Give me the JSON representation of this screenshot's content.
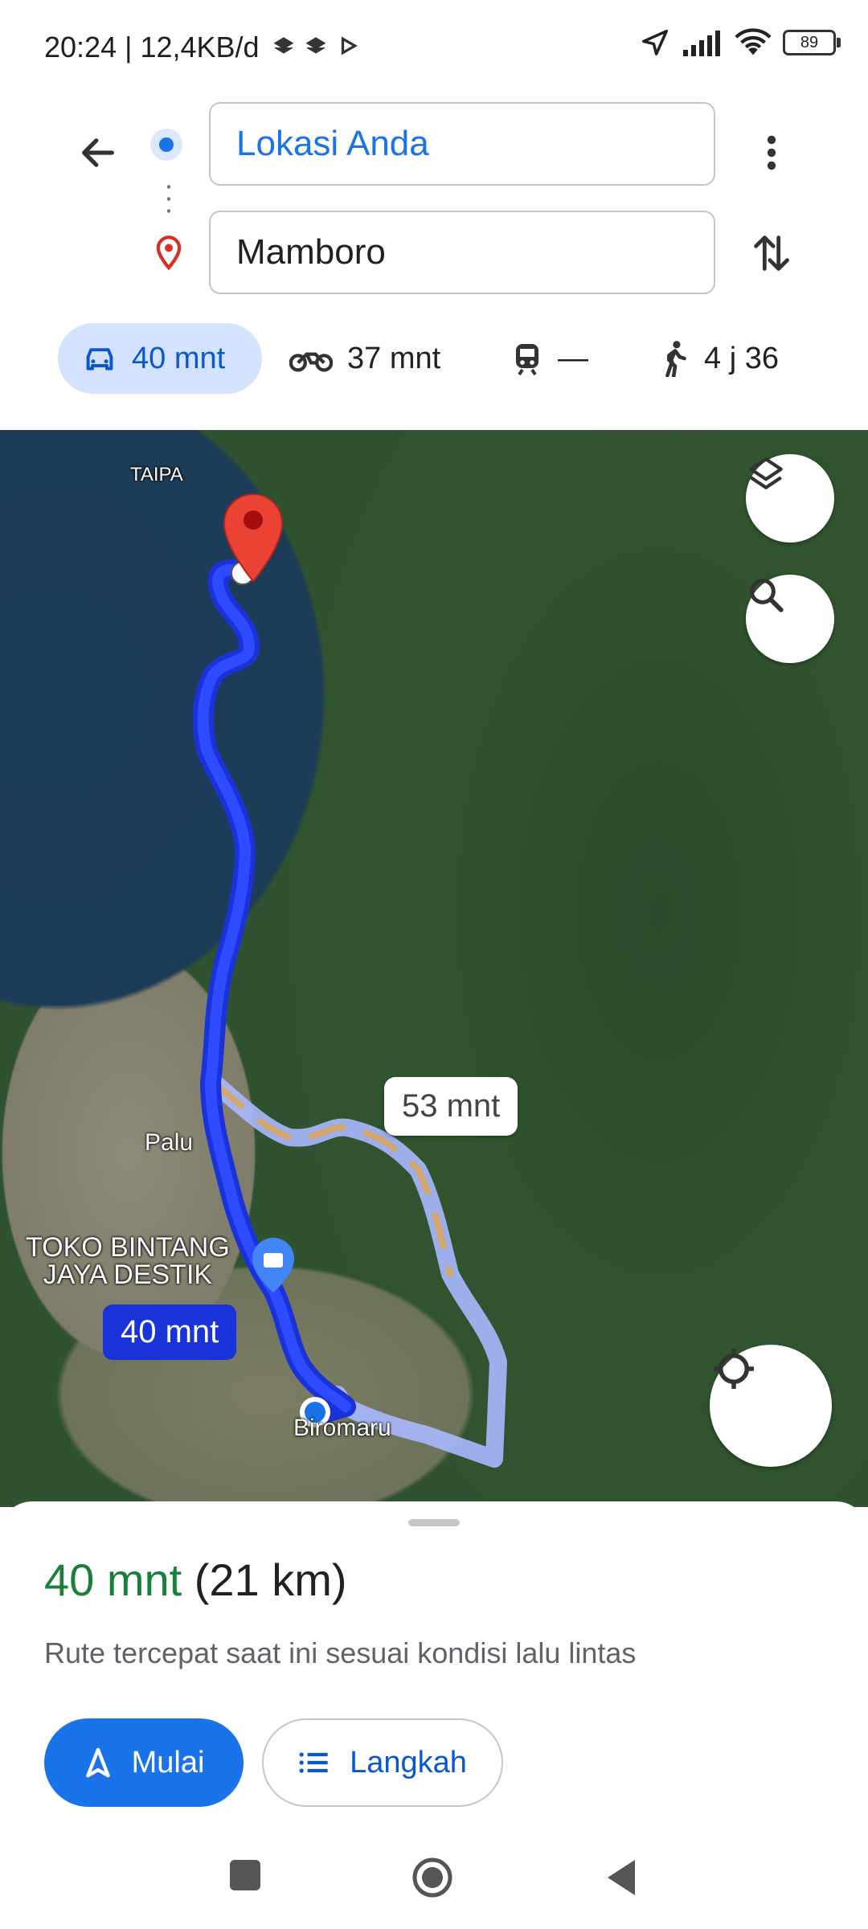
{
  "status_bar": {
    "time_info": "20:24 | 12,4KB/d",
    "battery": "89",
    "icons": [
      "layers-icon",
      "layers-icon",
      "play-icon",
      "navigation-arrow-icon",
      "signal-icon",
      "wifi-icon",
      "battery-icon"
    ]
  },
  "header": {
    "back_icon": "back-arrow-icon",
    "origin_value": "Lokasi Anda",
    "destination_value": "Mamboro",
    "menu_icon": "more-vert-icon",
    "swap_icon": "swap-vert-icon"
  },
  "modes": [
    {
      "icon": "car-icon",
      "label": "40 mnt",
      "selected": true
    },
    {
      "icon": "motorcycle-icon",
      "label": "37 mnt",
      "selected": false
    },
    {
      "icon": "train-icon",
      "label": "—",
      "selected": false
    },
    {
      "icon": "walk-icon",
      "label": "4 j 36",
      "selected": false
    }
  ],
  "map": {
    "labels": {
      "taipa": "TAIPA",
      "palu": "Palu",
      "store": "TOKO BINTANG\nJAYA DESTIK",
      "biromaru": "Biromaru"
    },
    "route_selected_label": "40 mnt",
    "route_alt_label": "53 mnt",
    "buttons": {
      "layers_icon": "layers-icon",
      "search_icon": "search-icon",
      "locate_icon": "my-location-icon"
    }
  },
  "sheet": {
    "eta_time": "40 mnt",
    "eta_distance": "(21 km)",
    "description": "Rute tercepat saat ini sesuai kondisi lalu lintas",
    "start_label": "Mulai",
    "steps_label": "Langkah"
  },
  "colors": {
    "accent": "#1a73e8",
    "route": "#1a33d8",
    "eta_green": "#188038",
    "pin_red": "#ea4335"
  }
}
